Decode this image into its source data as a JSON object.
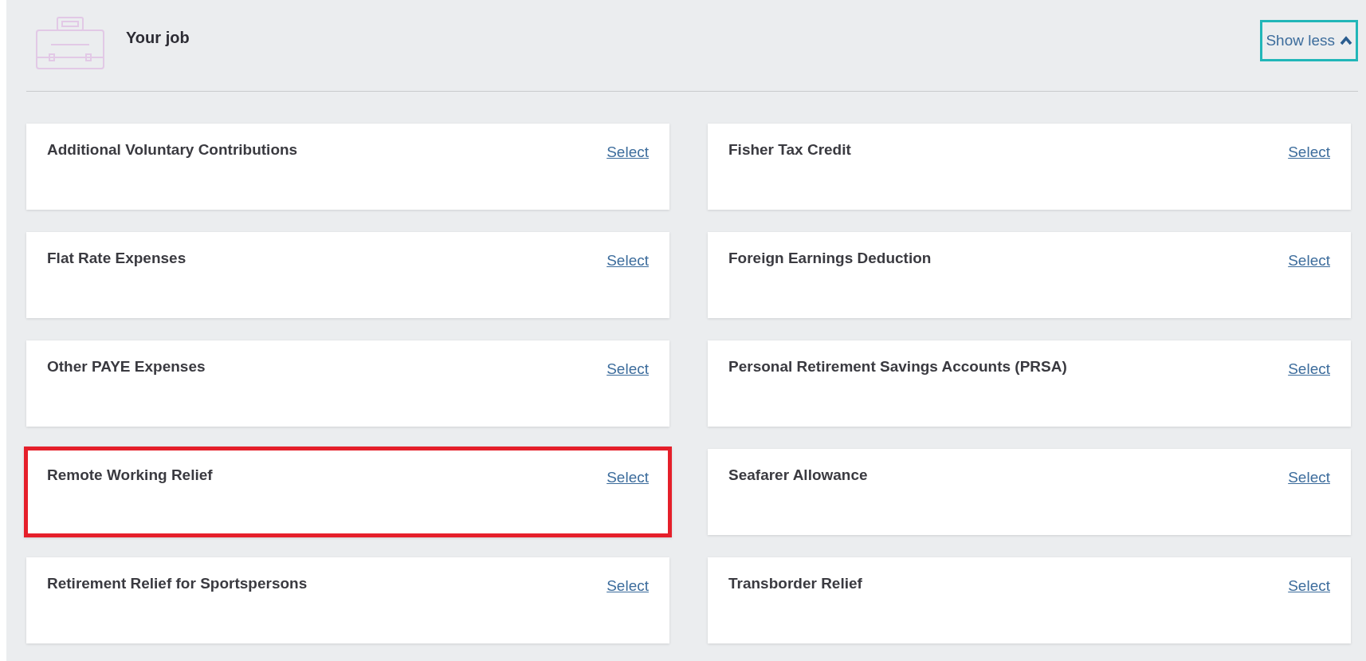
{
  "section": {
    "title": "Your job",
    "toggle": {
      "label": "Show less",
      "expanded": true,
      "highlighted": true
    }
  },
  "cards": [
    {
      "title": "Additional Voluntary Contributions",
      "action": "Select",
      "highlighted": false
    },
    {
      "title": "Fisher Tax Credit",
      "action": "Select",
      "highlighted": false
    },
    {
      "title": "Flat Rate Expenses",
      "action": "Select",
      "highlighted": false
    },
    {
      "title": "Foreign Earnings Deduction",
      "action": "Select",
      "highlighted": false
    },
    {
      "title": "Other PAYE Expenses",
      "action": "Select",
      "highlighted": false
    },
    {
      "title": "Personal Retirement Savings Accounts (PRSA)",
      "action": "Select",
      "highlighted": false
    },
    {
      "title": "Remote Working Relief",
      "action": "Select",
      "highlighted": true
    },
    {
      "title": "Seafarer Allowance",
      "action": "Select",
      "highlighted": false
    },
    {
      "title": "Retirement Relief for Sportspersons",
      "action": "Select",
      "highlighted": false
    },
    {
      "title": "Transborder Relief",
      "action": "Select",
      "highlighted": false
    }
  ]
}
